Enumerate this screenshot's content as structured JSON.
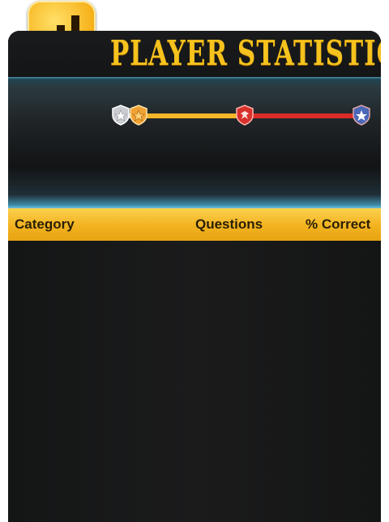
{
  "header": {
    "title": "PLAYER STATISTICS",
    "icon": "bar-chart-icon"
  },
  "progress": {
    "ranks": [
      {
        "icon": "silver-shield-star-icon",
        "color": "#c9ccd2"
      },
      {
        "icon": "bronze-shield-star-icon",
        "color": "#f0a234"
      },
      {
        "icon": "red-shield-eagle-icon",
        "color": "#d8312c"
      },
      {
        "icon": "blue-shield-star-icon",
        "color": "#4a67b8"
      }
    ],
    "colors": {
      "gold": "#f7b52a",
      "red": "#d92c28",
      "silver": "#d8d8d8"
    }
  },
  "table": {
    "columns": {
      "category": "Category",
      "questions": "Questions",
      "correct": "% Correct"
    },
    "rows": []
  },
  "colors": {
    "accent": "#f6c21d",
    "panel": "#151617",
    "header_bar": "#f2b21f"
  }
}
